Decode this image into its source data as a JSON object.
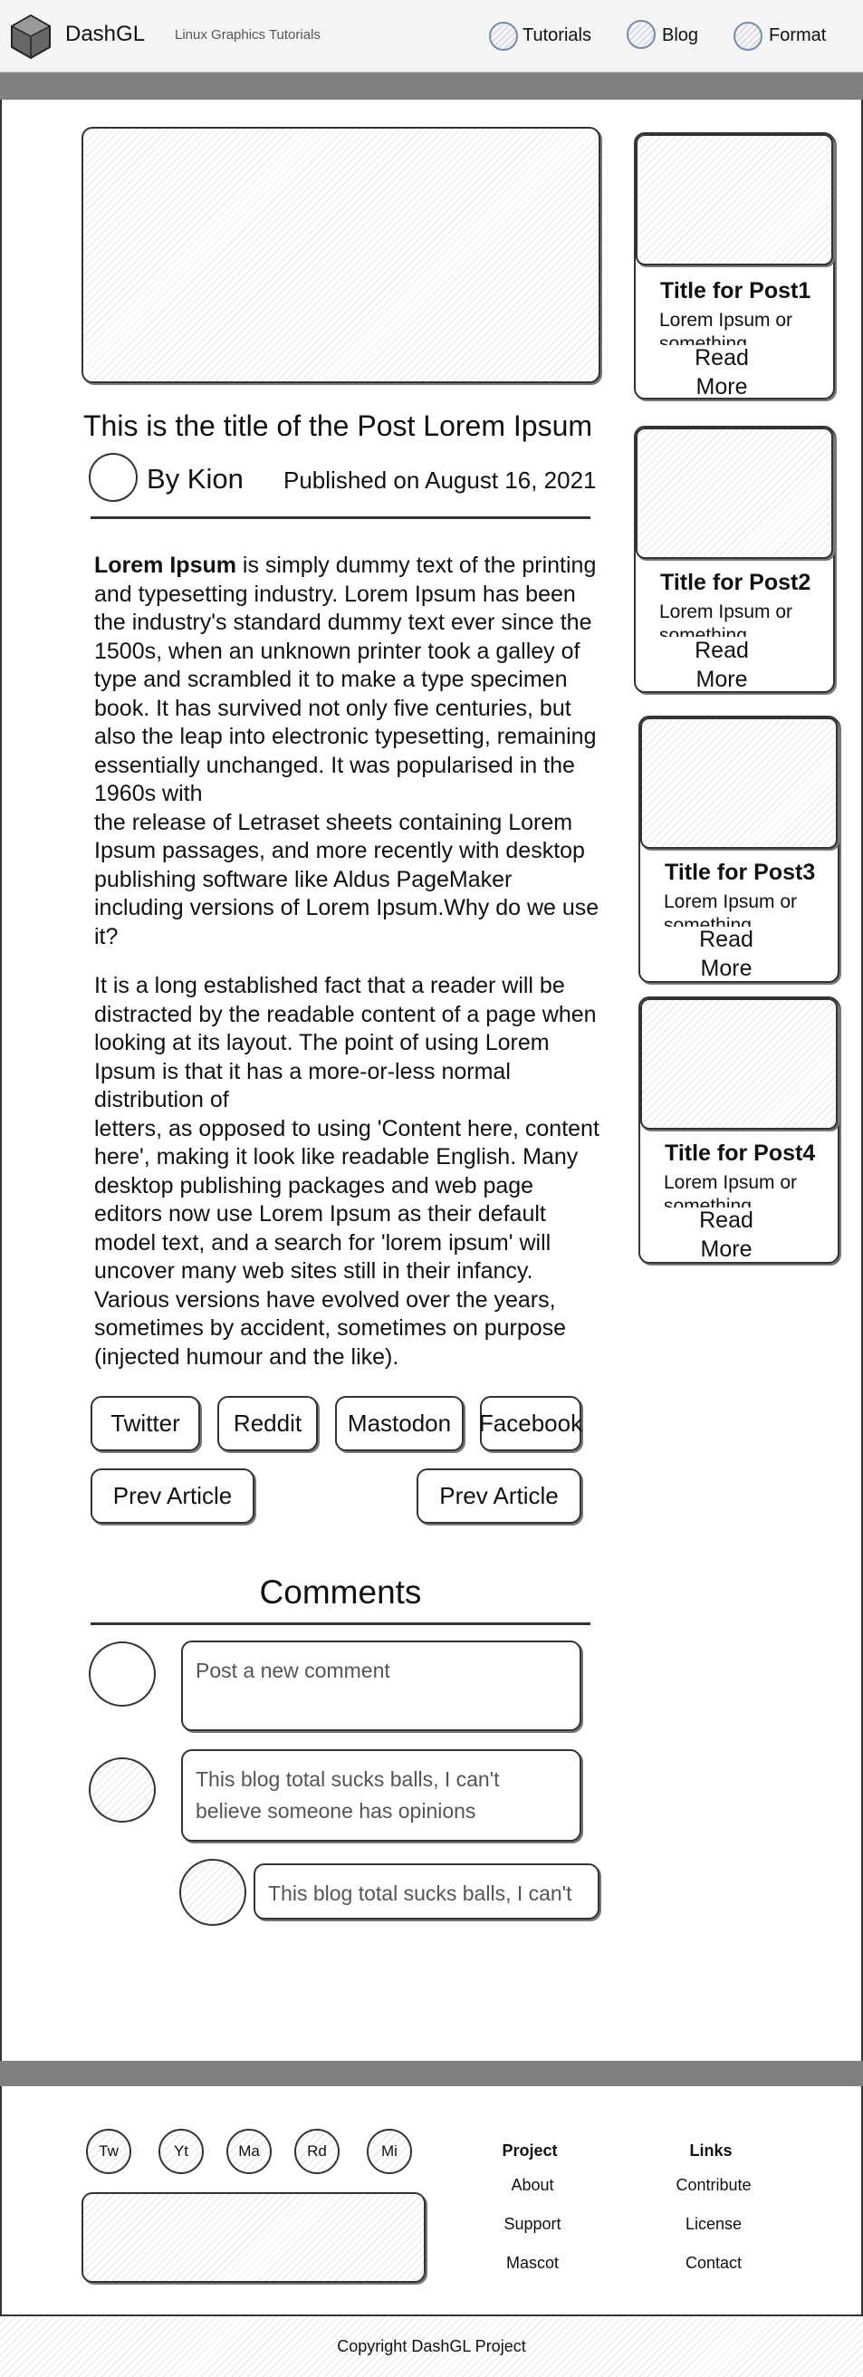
{
  "header": {
    "logo": "DashGL",
    "tagline": "Linux Graphics Tutorials",
    "nav": [
      {
        "label": "Tutorials",
        "icon": "globe-icon"
      },
      {
        "label": "Blog",
        "icon": "globe-icon"
      },
      {
        "label": "Format",
        "icon": "globe-icon"
      }
    ]
  },
  "post": {
    "title": "This is the title of the Post Lorem Ipsum",
    "author": "By Kion",
    "published": "Published on August 16, 2021",
    "p1_bold": "Lorem Ipsum",
    "p1_rest": " is simply dummy text of the printing and typesetting industry. Lorem Ipsum has been the industry's standard dummy text ever since the 1500s, when an unknown printer took a galley of type and scrambled it to make a type specimen book. It has survived not only five centuries, but also the leap into electronic typesetting, remaining essentially unchanged. It was popularised in the 1960s with",
    "p1_cont": "the release of Letraset sheets containing Lorem Ipsum passages, and more recently with desktop publishing software like Aldus PageMaker including versions of Lorem Ipsum.Why do we use it?",
    "p2": "It is a long established fact that a reader will be distracted by the readable content of a page when looking at its layout. The point of using Lorem Ipsum is that it has a more-or-less normal distribution of",
    "p2_cont": "letters, as opposed to using 'Content here, content here', making it look like readable English. Many desktop publishing packages and web page editors now use Lorem Ipsum as their default model text, and a search for 'lorem ipsum' will uncover many web sites still in their infancy. Various versions have evolved over the years, sometimes by accident, sometimes on purpose (injected humour and the like)."
  },
  "share": [
    "Twitter",
    "Reddit",
    "Mastodon",
    "Facebook"
  ],
  "pager": {
    "prev": "Prev Article",
    "next": "Prev Article"
  },
  "comments": {
    "heading": "Comments",
    "new_placeholder": "Post a new comment",
    "items": [
      {
        "text": "This blog total sucks balls, I can't believe someone has opinions"
      },
      {
        "text": "This blog total sucks balls, I can't"
      }
    ]
  },
  "sidebar": [
    {
      "title": "Title for Post1",
      "desc": "Lorem Ipsum or something...",
      "more": "Read More"
    },
    {
      "title": "Title for Post2",
      "desc": "Lorem Ipsum or something...",
      "more": "Read More"
    },
    {
      "title": "Title for Post3",
      "desc": "Lorem Ipsum or something...",
      "more": "Read More"
    },
    {
      "title": "Title for Post4",
      "desc": "Lorem Ipsum or something...",
      "more": "Read More"
    }
  ],
  "footer": {
    "social": [
      "Tw",
      "Yt",
      "Ma",
      "Rd",
      "Mi"
    ],
    "project_heading": "Project",
    "project_links": [
      "About",
      "Support",
      "Mascot"
    ],
    "links_heading": "Links",
    "links": [
      "Contribute",
      "License",
      "Contact"
    ],
    "copyright": "Copyright DashGL Project"
  }
}
